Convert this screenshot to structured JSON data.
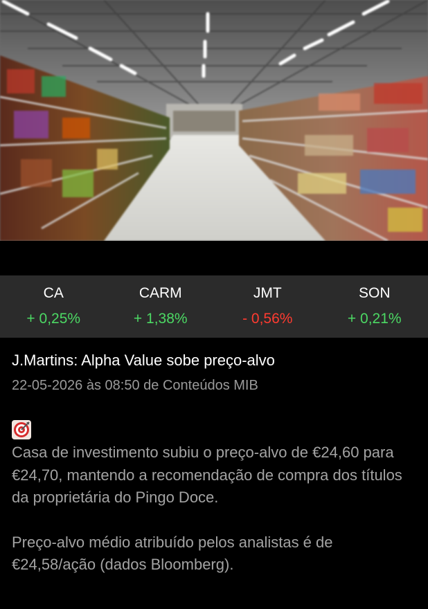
{
  "hero": {
    "icon": "supermarket-aisle-photo"
  },
  "tickers": [
    {
      "symbol": "CA",
      "change": "+ 0,25%",
      "direction": "up"
    },
    {
      "symbol": "CARM",
      "change": "+ 1,38%",
      "direction": "up"
    },
    {
      "symbol": "JMT",
      "change": "- 0,56%",
      "direction": "down"
    },
    {
      "symbol": "SON",
      "change": "+ 0,21%",
      "direction": "up"
    }
  ],
  "colors": {
    "up": "#4cd964",
    "down": "#ff3b30",
    "ticker_bg": "#2b2b2b"
  },
  "article": {
    "title": "J.Martins: Alpha Value sobe preço-alvo",
    "meta": "22-05-2026 às 08:50 de Conteúdos MIB",
    "icon": "direct-hit-target-icon",
    "paragraphs": [
      "Casa de investimento subiu o preço-alvo de €24,60 para €24,70, mantendo a recomendação de compra dos títulos da proprietária do Pingo Doce.",
      "Preço-alvo médio atribuído pelos analistas é de €24,58/ação (dados Bloomberg)."
    ]
  }
}
